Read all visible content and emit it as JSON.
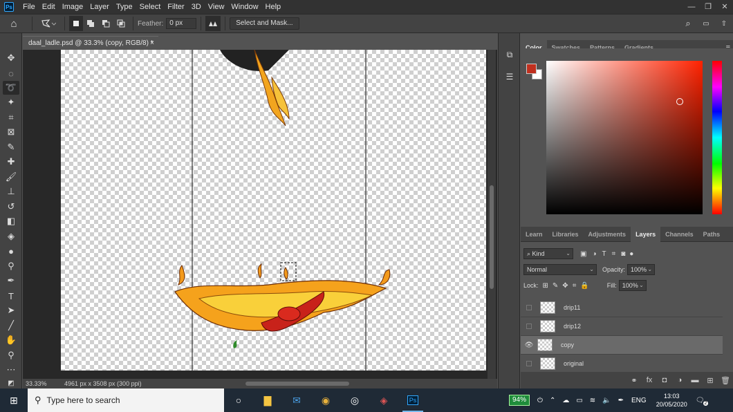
{
  "menubar": {
    "logo": "Ps",
    "items": [
      "File",
      "Edit",
      "Image",
      "Layer",
      "Type",
      "Select",
      "Filter",
      "3D",
      "View",
      "Window",
      "Help"
    ]
  },
  "optionsbar": {
    "feather_label": "Feather:",
    "feather_value": "0 px",
    "select_mask_label": "Select and Mask..."
  },
  "document": {
    "tab_title": "daal_ladle.psd @ 33.3% (copy, RGB/8) *",
    "zoom": "33.33%",
    "dimensions": "4961 px x 3508 px (300 ppi)"
  },
  "color_panel": {
    "tabs": [
      "Color",
      "Swatches",
      "Patterns",
      "Gradients"
    ],
    "foreground": "#c0301f",
    "background": "#ffffff"
  },
  "layers_panel": {
    "tabs": [
      "Learn",
      "Libraries",
      "Adjustments",
      "Layers",
      "Channels",
      "Paths"
    ],
    "filter_kind": "Kind",
    "blend_mode": "Normal",
    "opacity_label": "Opacity:",
    "opacity": "100%",
    "lock_label": "Lock:",
    "fill_label": "Fill:",
    "fill": "100%",
    "layers": [
      {
        "name": "drip11",
        "visible": false,
        "selected": false
      },
      {
        "name": "drip12",
        "visible": false,
        "selected": false
      },
      {
        "name": "copy",
        "visible": true,
        "selected": true
      },
      {
        "name": "original",
        "visible": false,
        "selected": false
      }
    ]
  },
  "taskbar": {
    "search_placeholder": "Type here to search",
    "battery": "94%",
    "language": "ENG",
    "time": "13:03",
    "date": "20/05/2020",
    "notifications": "2"
  }
}
